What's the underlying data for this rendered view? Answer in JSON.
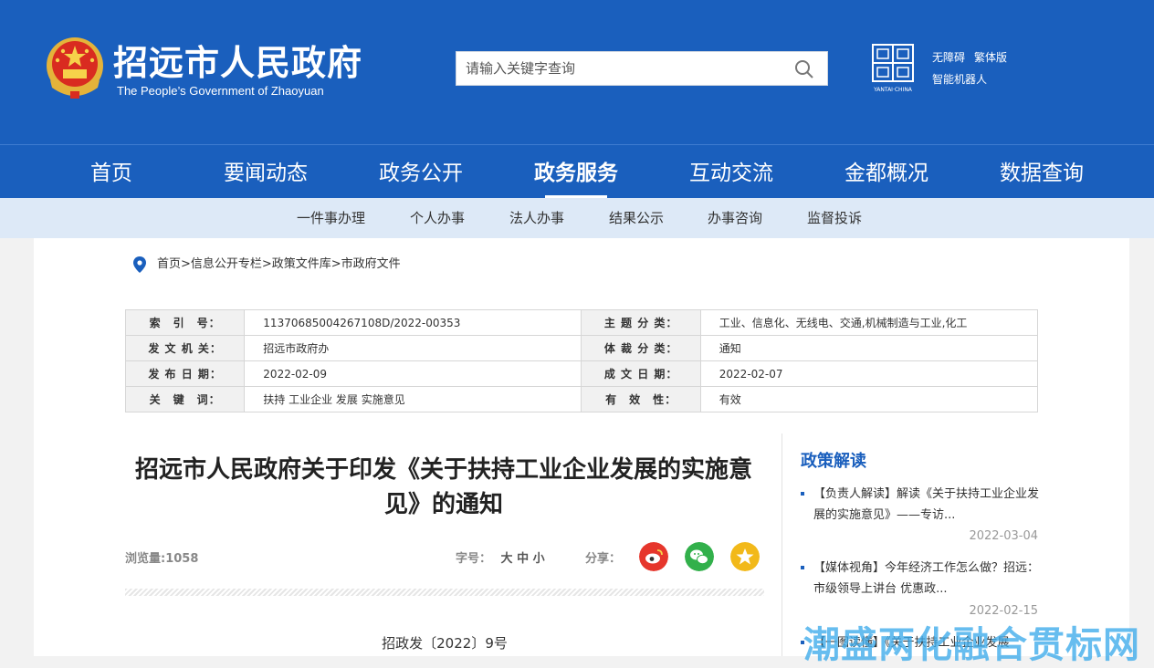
{
  "header": {
    "title": "招远市人民政府",
    "subtitle": "The People’s Government of Zhaoyuan",
    "search_placeholder": "请输入关键字查询",
    "links": [
      "无障碍",
      "繁体版",
      "智能机器人"
    ],
    "logo_text": "YANTAI·CHINA"
  },
  "nav": {
    "items": [
      "首页",
      "要闻动态",
      "政务公开",
      "政务服务",
      "互动交流",
      "金都概况",
      "数据查询"
    ],
    "active": "政务服务"
  },
  "subnav": {
    "items": [
      "一件事办理",
      "个人办事",
      "法人办事",
      "结果公示",
      "办事咨询",
      "监督投诉"
    ]
  },
  "breadcrumb": "首页>信息公开专栏>政策文件库>市政府文件",
  "meta": {
    "rows": [
      {
        "l1": "索　引　号：",
        "v1": "11370685004267108D/2022-00353",
        "l2": "主 题 分 类：",
        "v2": "工业、信息化、无线电、交通,机械制造与工业,化工"
      },
      {
        "l1": "发 文 机 关：",
        "v1": "招远市政府办",
        "l2": "体 裁 分 类：",
        "v2": "通知"
      },
      {
        "l1": "发 布 日 期：",
        "v1": "2022-02-09",
        "l2": "成 文 日 期：",
        "v2": "2022-02-07"
      },
      {
        "l1": "关　键　词：",
        "v1": "扶持 工业企业 发展 实施意见",
        "l2": "有　效　性：",
        "v2": "有效"
      }
    ]
  },
  "article": {
    "title": "招远市人民政府关于印发《关于扶持工业企业发展的实施意见》的通知",
    "views": "浏览量:1058",
    "font_size_label": "字号：",
    "font_sizes": "大 中 小",
    "share_label": "分享：",
    "doc_number": "招政发〔2022〕9号"
  },
  "sidebar": {
    "heading": "政策解读",
    "items": [
      {
        "text": "【负责人解读】解读《关于扶持工业企业发展的实施意见》——专访...",
        "date": "2022-03-04"
      },
      {
        "text": "【媒体视角】今年经济工作怎么做？招远：市级领导上讲台 优惠政...",
        "date": "2022-02-15"
      },
      {
        "text": "【一图读懂】《关于扶持工业企业发展",
        "date": ""
      }
    ]
  },
  "watermark": "潮盛两化融合贯标网",
  "colors": {
    "primary": "#1a5fbd",
    "subnav_bg": "#dde9f7",
    "weibo": "#e6362c",
    "wechat": "#32b04b",
    "qzone": "#f2b91a"
  }
}
